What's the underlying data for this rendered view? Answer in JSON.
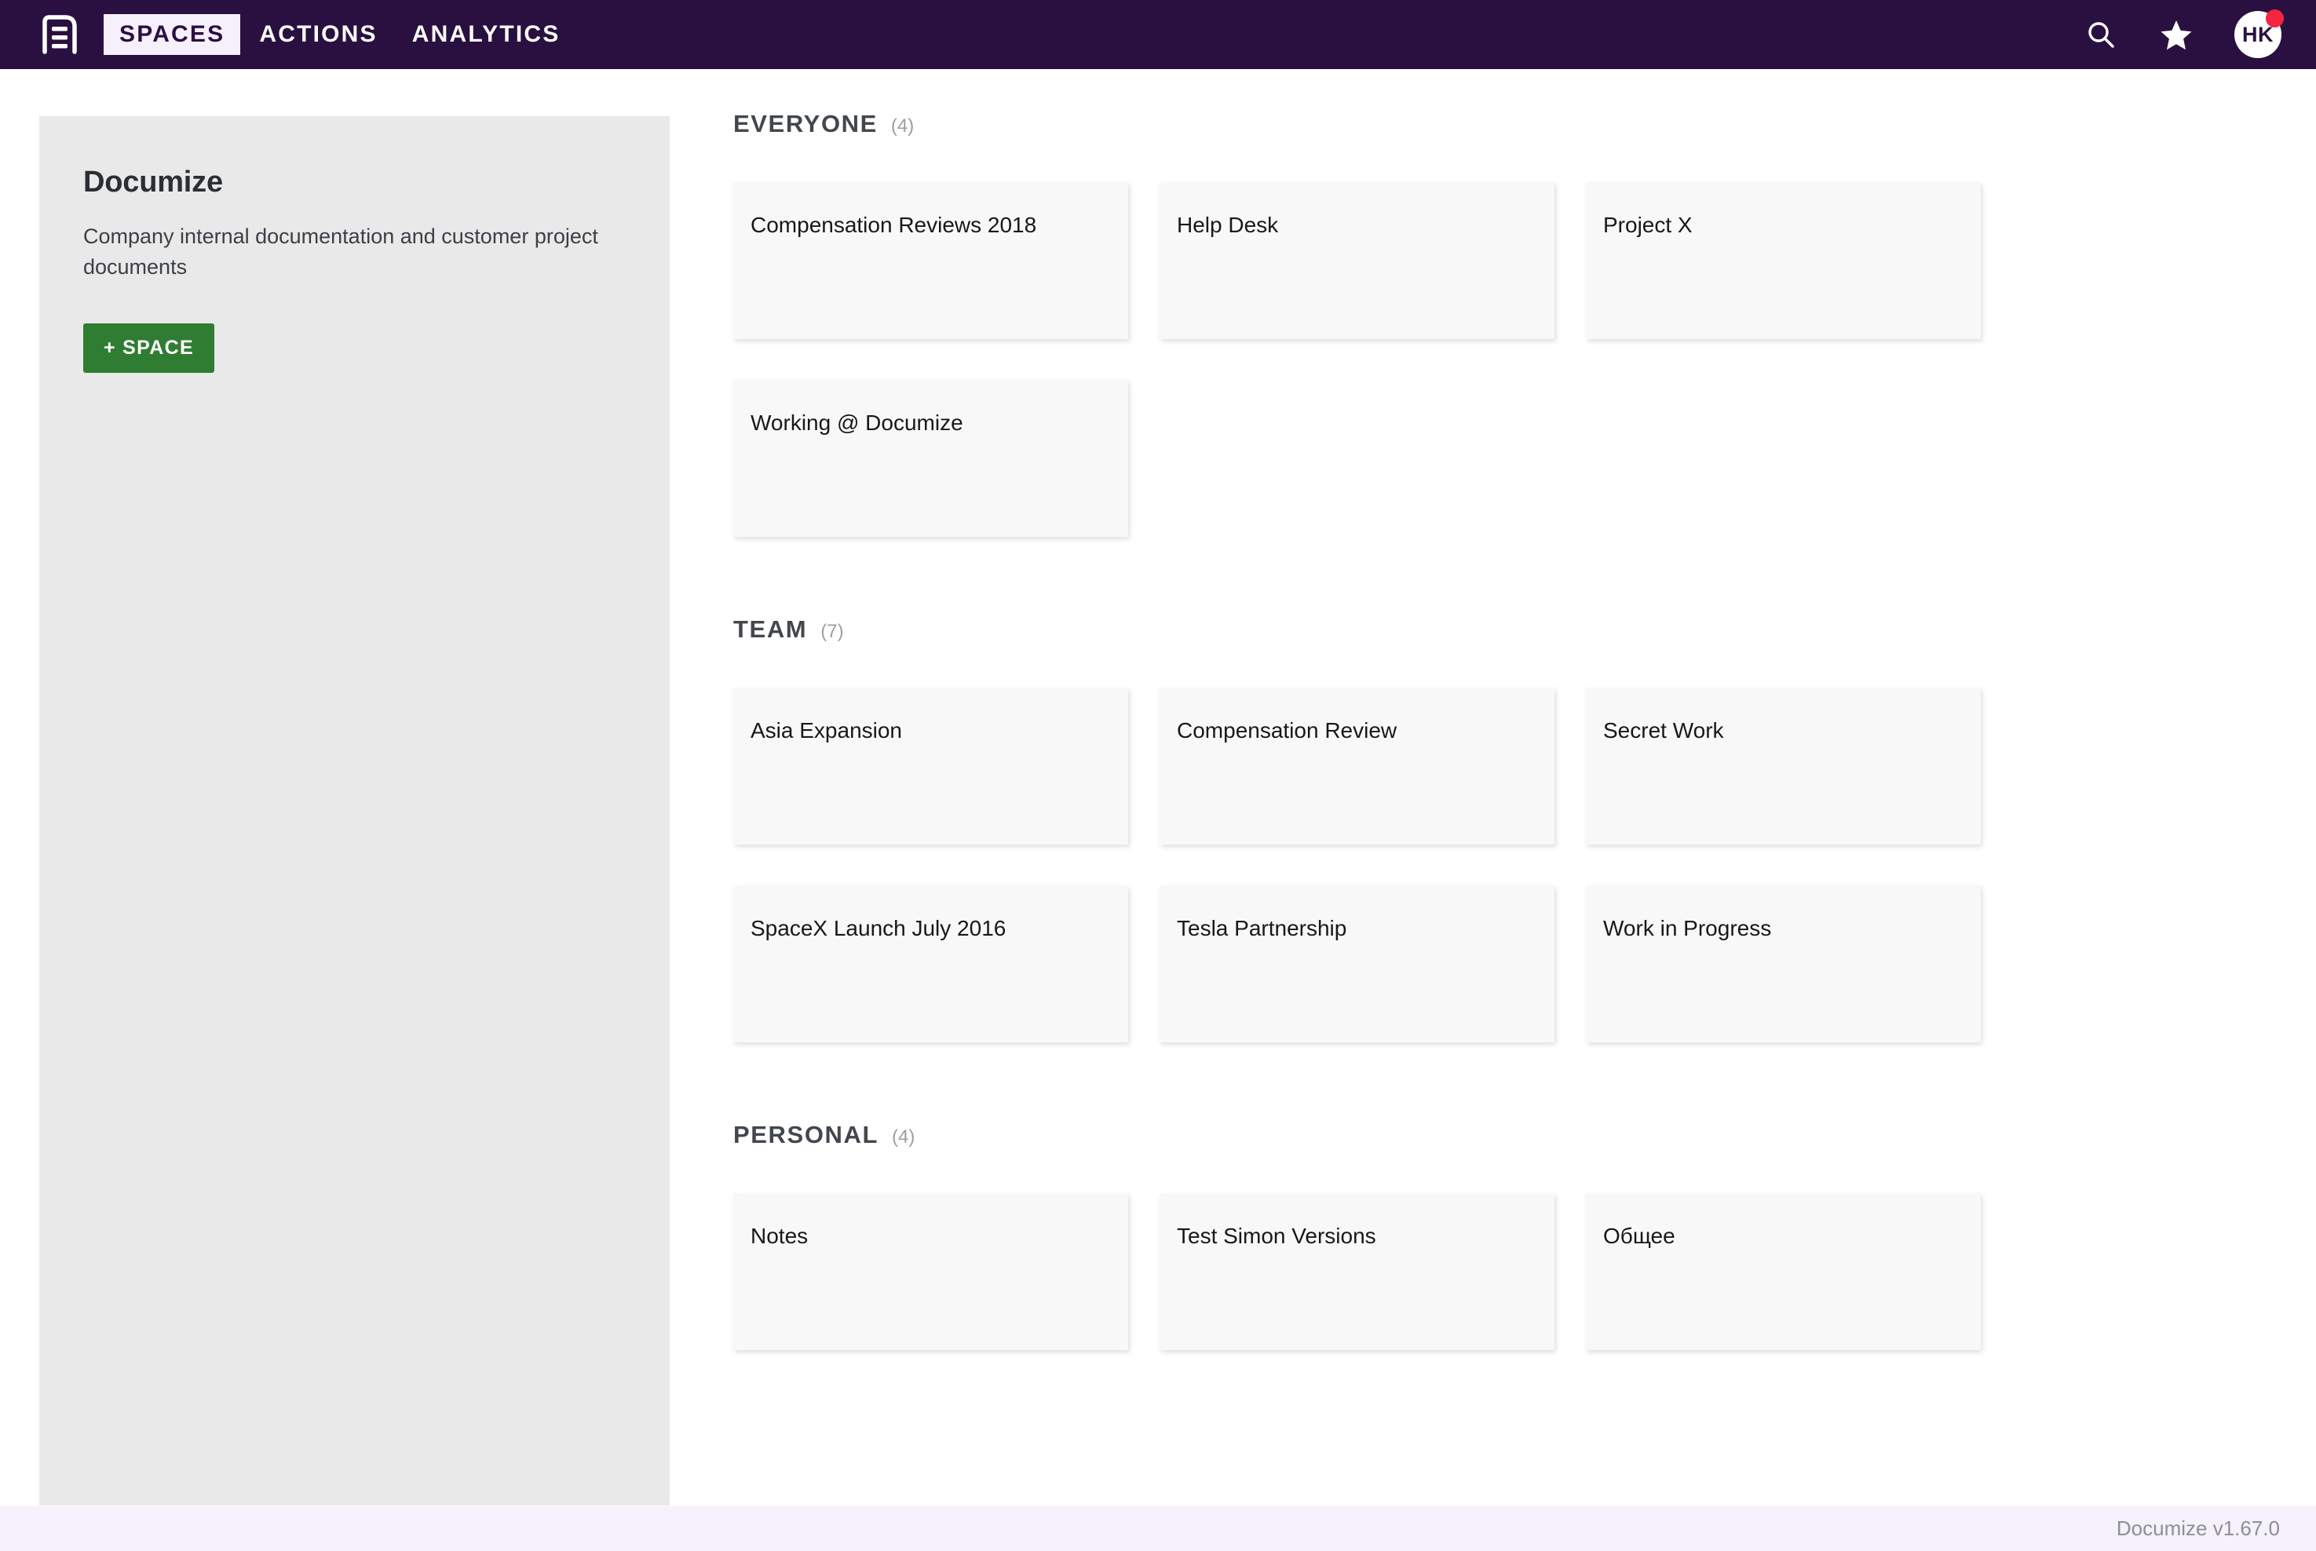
{
  "navbar": {
    "logo_icon": "document-lines-icon",
    "links": [
      {
        "label": "SPACES",
        "active": true
      },
      {
        "label": "ACTIONS",
        "active": false
      },
      {
        "label": "ANALYTICS",
        "active": false
      }
    ],
    "search_icon": "search-icon",
    "star_icon": "star-icon",
    "avatar_initials": "HK",
    "has_notification": true,
    "background_color": "#2a1040",
    "active_tab_background": "#f6f0fd",
    "notification_color": "#f5243f"
  },
  "side_panel": {
    "title": "Documize",
    "description": "Company internal documentation and customer project documents",
    "add_space_label": "+ SPACE",
    "add_space_color": "#2f7d32",
    "background_color": "#e9e9e9"
  },
  "sections": [
    {
      "title": "EVERYONE",
      "count": "(4)",
      "cards": [
        {
          "title": "Compensation Reviews 2018"
        },
        {
          "title": "Help Desk"
        },
        {
          "title": "Project X"
        },
        {
          "title": "Working @ Documize"
        }
      ]
    },
    {
      "title": "TEAM",
      "count": "(7)",
      "cards": [
        {
          "title": "Asia Expansion"
        },
        {
          "title": "Compensation Review"
        },
        {
          "title": "Secret Work"
        },
        {
          "title": "SpaceX Launch July 2016"
        },
        {
          "title": "Tesla Partnership"
        },
        {
          "title": "Work in Progress"
        }
      ]
    },
    {
      "title": "PERSONAL",
      "count": "(4)",
      "cards": [
        {
          "title": "Notes"
        },
        {
          "title": "Test Simon Versions"
        },
        {
          "title": "Общее"
        }
      ]
    }
  ],
  "footer": {
    "version_text": "Documize v1.67.0",
    "background_color": "#f5f1fd"
  }
}
